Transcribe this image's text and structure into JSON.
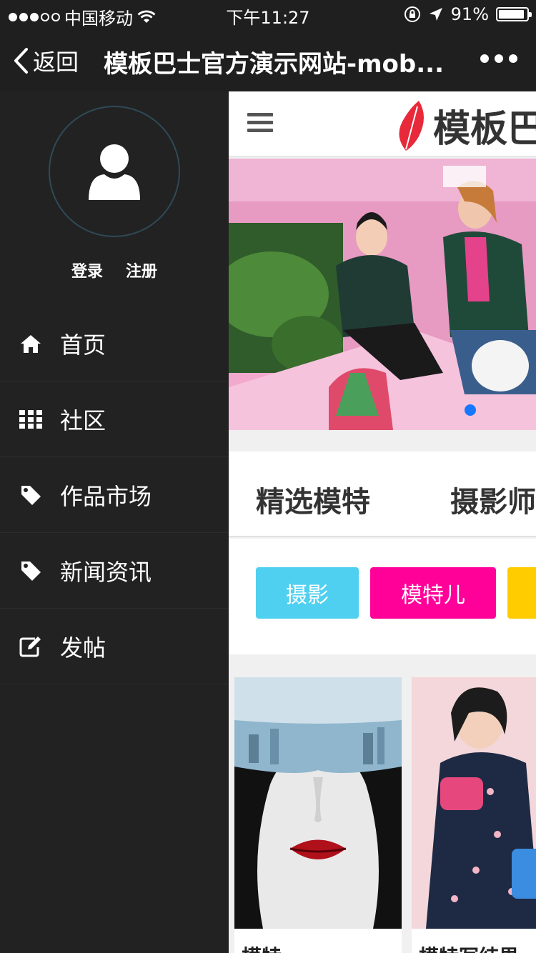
{
  "status": {
    "carrier": "中国移动",
    "time": "下午11:27",
    "battery_text": "91%",
    "battery_level": 0.91,
    "signal_bars_filled": 3,
    "signal_bars_total": 5
  },
  "nav": {
    "back_label": "返回",
    "title": "模板巴士官方演示网站-mob..."
  },
  "sidebar": {
    "login": "登录",
    "register": "注册",
    "items": [
      {
        "label": "首页",
        "icon": "home-icon"
      },
      {
        "label": "社区",
        "icon": "grid-icon"
      },
      {
        "label": "作品市场",
        "icon": "tag-icon"
      },
      {
        "label": "新闻资讯",
        "icon": "tag-icon"
      },
      {
        "label": "发帖",
        "icon": "edit-icon"
      }
    ]
  },
  "page": {
    "logo_text": "模板巴",
    "tabs": [
      "精选模特",
      "摄影师"
    ],
    "tags": [
      {
        "label": "摄影",
        "color": "#4fd0f0"
      },
      {
        "label": "模特儿",
        "color": "#ff0099"
      },
      {
        "label": "",
        "color": "#ffcc00"
      }
    ],
    "cards": [
      {
        "caption": "模特"
      },
      {
        "caption": "模特写结果"
      }
    ]
  },
  "colors": {
    "sidebar_bg": "#222222",
    "accent_blue": "#1677ff",
    "logo_red": "#e8293a"
  }
}
